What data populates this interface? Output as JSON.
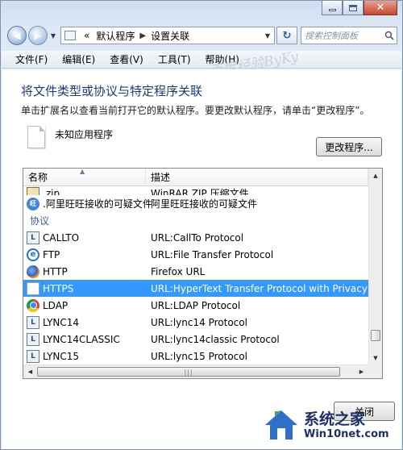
{
  "window": {
    "address": {
      "crumb_prefix": "«",
      "crumbs": [
        "默认程序",
        "设置关联"
      ]
    },
    "search_placeholder": "搜索控制面板",
    "menu": [
      "文件(F)",
      "编辑(E)",
      "查看(V)",
      "工具(T)",
      "帮助(H)"
    ],
    "watermark": "百度经验ByKy"
  },
  "content": {
    "heading": "将文件类型或协议与特定程序关联",
    "description": "单击扩展名以查看当前打开它的默认程序。要更改默认程序，请单击“更改程序”。",
    "current_app": "未知应用程序",
    "change_button": "更改程序..."
  },
  "list": {
    "columns": [
      "名称",
      "描述"
    ],
    "rows": [
      {
        "name": ".zip",
        "desc": "WinRAR ZIP 压缩文件",
        "icon": "zip-icon",
        "cut": true
      },
      {
        "name": ".阿里旺旺接收的可疑文件",
        "desc": "阿里旺旺接收的可疑文件",
        "icon": "aliwangwang-icon"
      }
    ],
    "group_label": "协议",
    "protocols": [
      {
        "name": "CALLTO",
        "desc": "URL:CallTo Protocol",
        "icon": "app-icon"
      },
      {
        "name": "FTP",
        "desc": "URL:File Transfer Protocol",
        "icon": "ie-icon"
      },
      {
        "name": "HTTP",
        "desc": "Firefox URL",
        "icon": "firefox-icon"
      },
      {
        "name": "HTTPS",
        "desc": "URL:HyperText Transfer Protocol with Privacy",
        "icon": "blank-icon",
        "selected": true
      },
      {
        "name": "LDAP",
        "desc": "URL:LDAP Protocol",
        "icon": "chrome-icon"
      },
      {
        "name": "LYNC14",
        "desc": "URL:lync14 Protocol",
        "icon": "app-icon"
      },
      {
        "name": "LYNC14CLASSIC",
        "desc": "URL:lync14classic Protocol",
        "icon": "app-icon"
      },
      {
        "name": "LYNC15",
        "desc": "URL:lync15 Protocol",
        "icon": "app-icon"
      }
    ]
  },
  "close_button": "关闭",
  "brand": {
    "title": "系统之家",
    "url": "Win10net.com"
  }
}
